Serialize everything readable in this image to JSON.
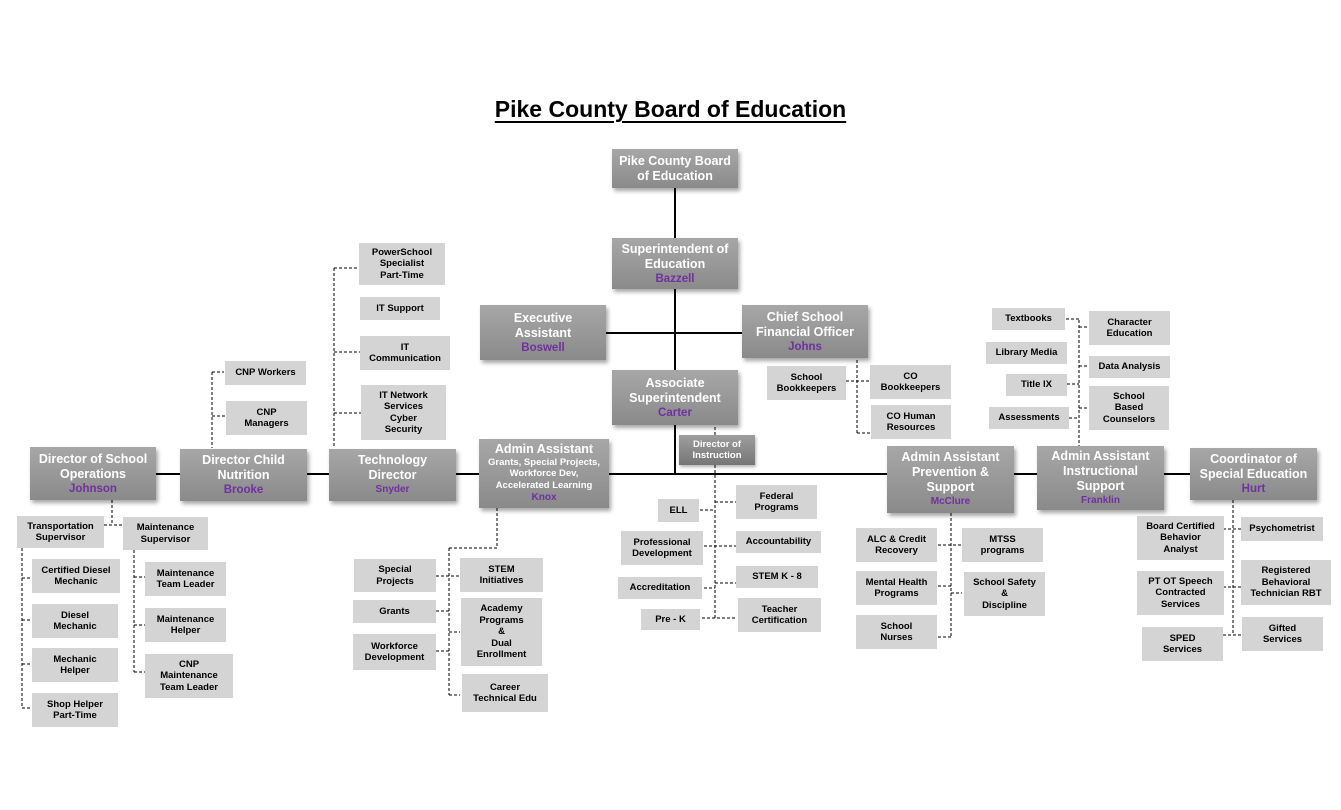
{
  "title": "Pike County Board of Education",
  "colors": {
    "name_accent": "#7030a0",
    "main_box": "#999999",
    "sub_box": "#d4d4d4"
  },
  "top": {
    "board": {
      "lines": [
        "Pike County Board",
        "of Education"
      ]
    },
    "superintendent": {
      "lines": [
        "Superintendent of",
        "Education"
      ],
      "name": "Bazzell"
    },
    "exec_assistant": {
      "lines": [
        "Executive",
        "Assistant"
      ],
      "name": "Boswell"
    },
    "cfo": {
      "lines": [
        "Chief School",
        "Financial Officer"
      ],
      "name": "Johns"
    },
    "assoc_super": {
      "lines": [
        "Associate",
        "Superintendent"
      ],
      "name": "Carter"
    },
    "dir_instruction": {
      "lines": [
        "Director of",
        "Instruction"
      ]
    }
  },
  "cfo_staff": {
    "school_bookkeepers": [
      "School",
      "Bookkeepers"
    ],
    "co_bookkeepers": [
      "CO",
      "Bookkeepers"
    ],
    "co_hr": [
      "CO Human",
      "Resources"
    ]
  },
  "directors": {
    "operations": {
      "lines": [
        "Director of School",
        "Operations"
      ],
      "name": "Johnson"
    },
    "nutrition": {
      "lines": [
        "Director Child",
        "Nutrition"
      ],
      "name": "Brooke"
    },
    "technology": {
      "lines": [
        "Technology",
        "Director"
      ],
      "name": "Snyder"
    },
    "admin_grants": {
      "lines": [
        "Admin Assistant"
      ],
      "sub": [
        "Grants, Special Projects,",
        "Workforce Dev,",
        "Accelerated Learning"
      ],
      "name": "Knox"
    },
    "admin_prevention": {
      "lines": [
        "Admin Assistant",
        "Prevention &",
        "Support"
      ],
      "name": "McClure"
    },
    "admin_instructional": {
      "lines": [
        "Admin Assistant",
        "Instructional",
        "Support"
      ],
      "name": "Franklin"
    },
    "sped_coord": {
      "lines": [
        "Coordinator of",
        "Special Education"
      ],
      "name": "Hurt"
    }
  },
  "operations_staff": {
    "transportation": [
      "Transportation",
      "Supervisor"
    ],
    "maintenance": [
      "Maintenance",
      "Supervisor"
    ],
    "transport_children": [
      [
        "Certified Diesel",
        "Mechanic"
      ],
      [
        "Diesel",
        "Mechanic"
      ],
      [
        "Mechanic",
        "Helper"
      ],
      [
        "Shop Helper",
        "Part-Time"
      ]
    ],
    "maintenance_children": [
      [
        "Maintenance",
        "Team Leader"
      ],
      [
        "Maintenance",
        "Helper"
      ],
      [
        "CNP",
        "Maintenance",
        "Team Leader"
      ]
    ]
  },
  "nutrition_staff": [
    [
      "CNP Workers"
    ],
    [
      "CNP",
      "Managers"
    ]
  ],
  "technology_staff": [
    [
      "PowerSchool",
      "Specialist",
      "Part-Time"
    ],
    [
      "IT Support"
    ],
    [
      "IT",
      "Communication"
    ],
    [
      "IT Network",
      "Services",
      "Cyber",
      "Security"
    ]
  ],
  "grants_staff": {
    "left": [
      [
        "Special",
        "Projects"
      ],
      [
        "Grants"
      ],
      [
        "Workforce",
        "Development"
      ]
    ],
    "right": [
      [
        "STEM",
        "Initiatives"
      ],
      [
        "Academy",
        "Programs",
        "&",
        "Dual",
        "Enrollment"
      ],
      [
        "Career",
        "Technical Edu"
      ]
    ]
  },
  "instruction_staff": {
    "left": [
      [
        "ELL"
      ],
      [
        "Professional",
        "Development"
      ],
      [
        "Accreditation"
      ],
      [
        "Pre - K"
      ]
    ],
    "right": [
      [
        "Federal",
        "Programs"
      ],
      [
        "Accountability"
      ],
      [
        "STEM K - 8"
      ],
      [
        "Teacher",
        "Certification"
      ]
    ]
  },
  "prevention_staff": {
    "left": [
      [
        "ALC & Credit",
        "Recovery"
      ],
      [
        "Mental Health",
        "Programs"
      ],
      [
        "School",
        "Nurses"
      ]
    ],
    "right": [
      [
        "MTSS",
        "programs"
      ],
      [
        "School Safety",
        "&",
        "Discipline"
      ]
    ]
  },
  "instructional_staff": {
    "left": [
      [
        "Textbooks"
      ],
      [
        "Library Media"
      ],
      [
        "Title IX"
      ],
      [
        "Assessments"
      ]
    ],
    "right": [
      [
        "Character",
        "Education"
      ],
      [
        "Data Analysis"
      ],
      [
        "School",
        "Based",
        "Counselors"
      ]
    ]
  },
  "sped_staff": {
    "left": [
      [
        "Board Certified",
        "Behavior",
        "Analyst"
      ],
      [
        "PT OT Speech",
        "Contracted",
        "Services"
      ],
      [
        "SPED",
        "Services"
      ]
    ],
    "right": [
      [
        "Psychometrist"
      ],
      [
        "Registered",
        "Behavioral",
        "Technician RBT"
      ],
      [
        "Gifted",
        "Services"
      ]
    ]
  }
}
